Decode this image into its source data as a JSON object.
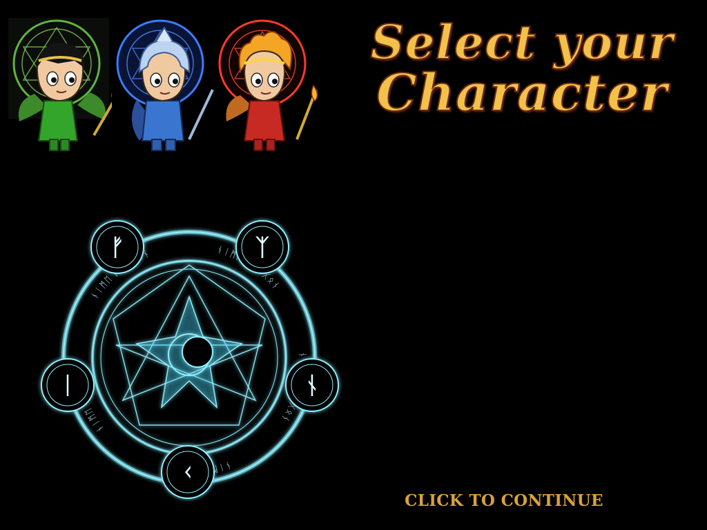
{
  "title": {
    "line1": "Select your",
    "line2": "Character"
  },
  "characters": [
    {
      "name_icon": "green-mage-portrait",
      "accent": "#4fc23a",
      "rune_ring": "#7de04a"
    },
    {
      "name_icon": "blue-knight-portrait",
      "accent": "#2f6fe0",
      "rune_ring": "#3e7dff"
    },
    {
      "name_icon": "red-fire-mage-portrait",
      "accent": "#d8342a",
      "rune_ring": "#ff3b2a"
    }
  ],
  "magic_circle": {
    "icon": "magic-summoning-circle",
    "glow_color": "#7fe9ff",
    "ring_text": [
      "ᚾᛁᛗᛖ ᛞᚱᚨᚷᛟᚾ",
      "ᚾᛁᛗᛖ ᛞᚱᚨᚷᛟᚾ",
      "ᚾᛁᛗᛖ ᛞᚱᚨᚷᛟᚾ",
      "ᚾᛁᛗᛖ ᛞᚱᚨᚷᛟᚾ",
      "ᚾᛁᛗᛖ ᛞᚱᚨᚷᛟᚾ"
    ],
    "node_runes": [
      "ᚠ",
      "ᛉ",
      "ᚾ",
      "ᚲ",
      "ᛁ"
    ]
  },
  "continue_label": "CLICK TO CONTINUE",
  "colors": {
    "title_fill": "#f2c14a",
    "title_stroke": "#6b2a14",
    "continue": "#d9a23a",
    "background": "#000000"
  }
}
